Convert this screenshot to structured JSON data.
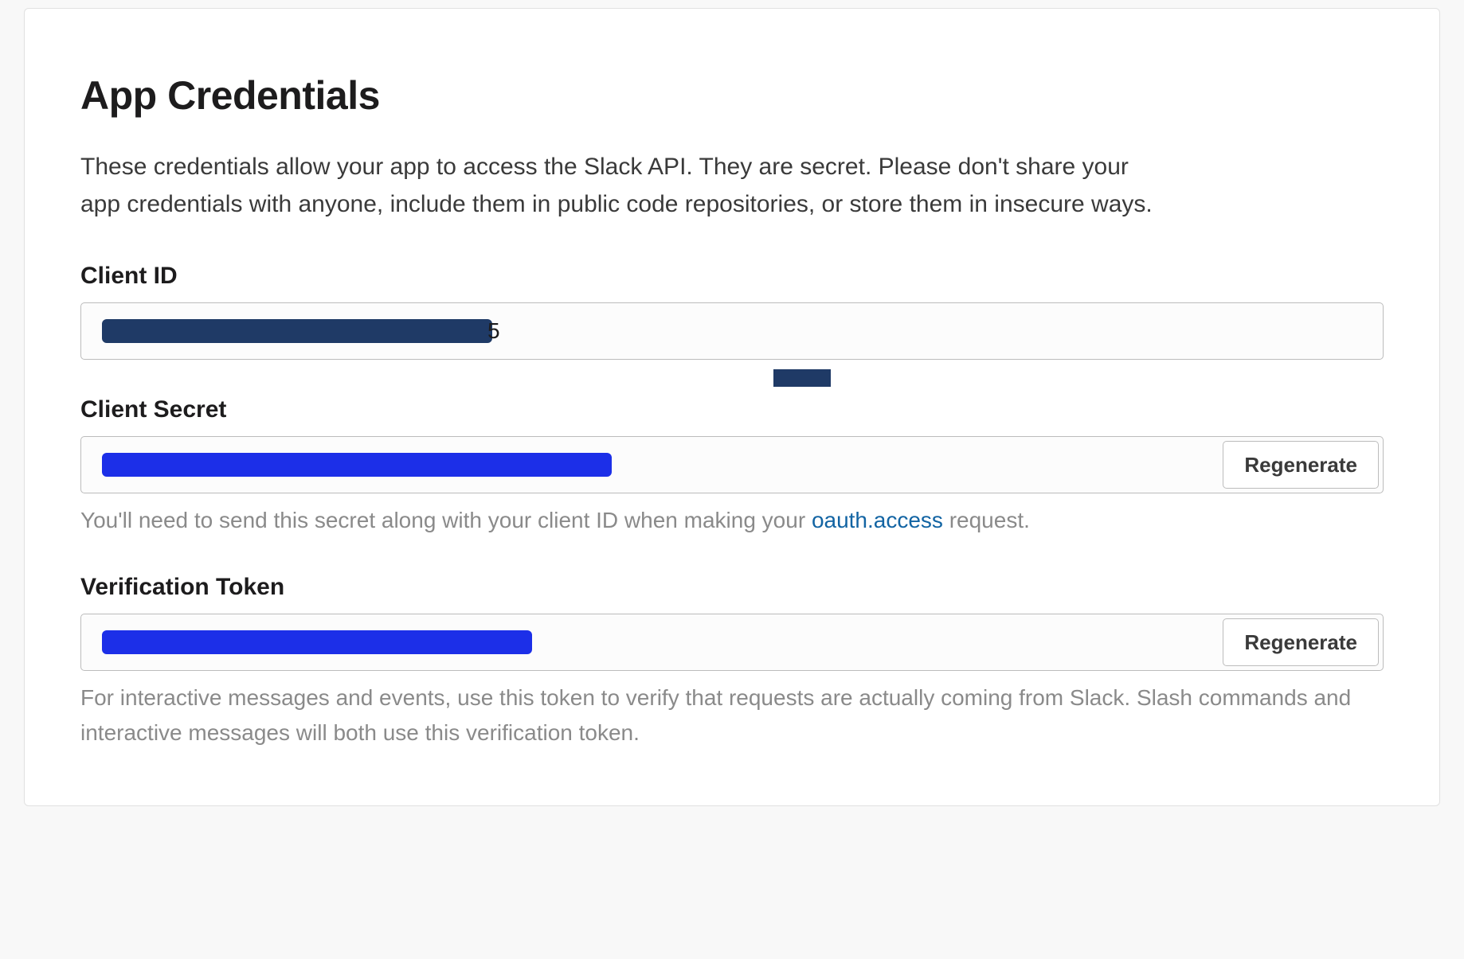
{
  "credentials": {
    "title": "App Credentials",
    "description": "These credentials allow your app to access the Slack API. They are secret. Please don't share your app credentials with anyone, include them in public code repositories, or store them in insecure ways.",
    "client_id": {
      "label": "Client ID",
      "value_redacted": true,
      "visible_tail": "5"
    },
    "client_secret": {
      "label": "Client Secret",
      "value_redacted": true,
      "regen_label": "Regenerate",
      "help_prefix": "You'll need to send this secret along with your client ID when making your ",
      "help_link_text": "oauth.access",
      "help_suffix": " request."
    },
    "verification_token": {
      "label": "Verification Token",
      "value_redacted": true,
      "regen_label": "Regenerate",
      "help": "For interactive messages and events, use this token to verify that requests are actually coming from Slack. Slash commands and interactive messages will both use this verification token."
    }
  }
}
